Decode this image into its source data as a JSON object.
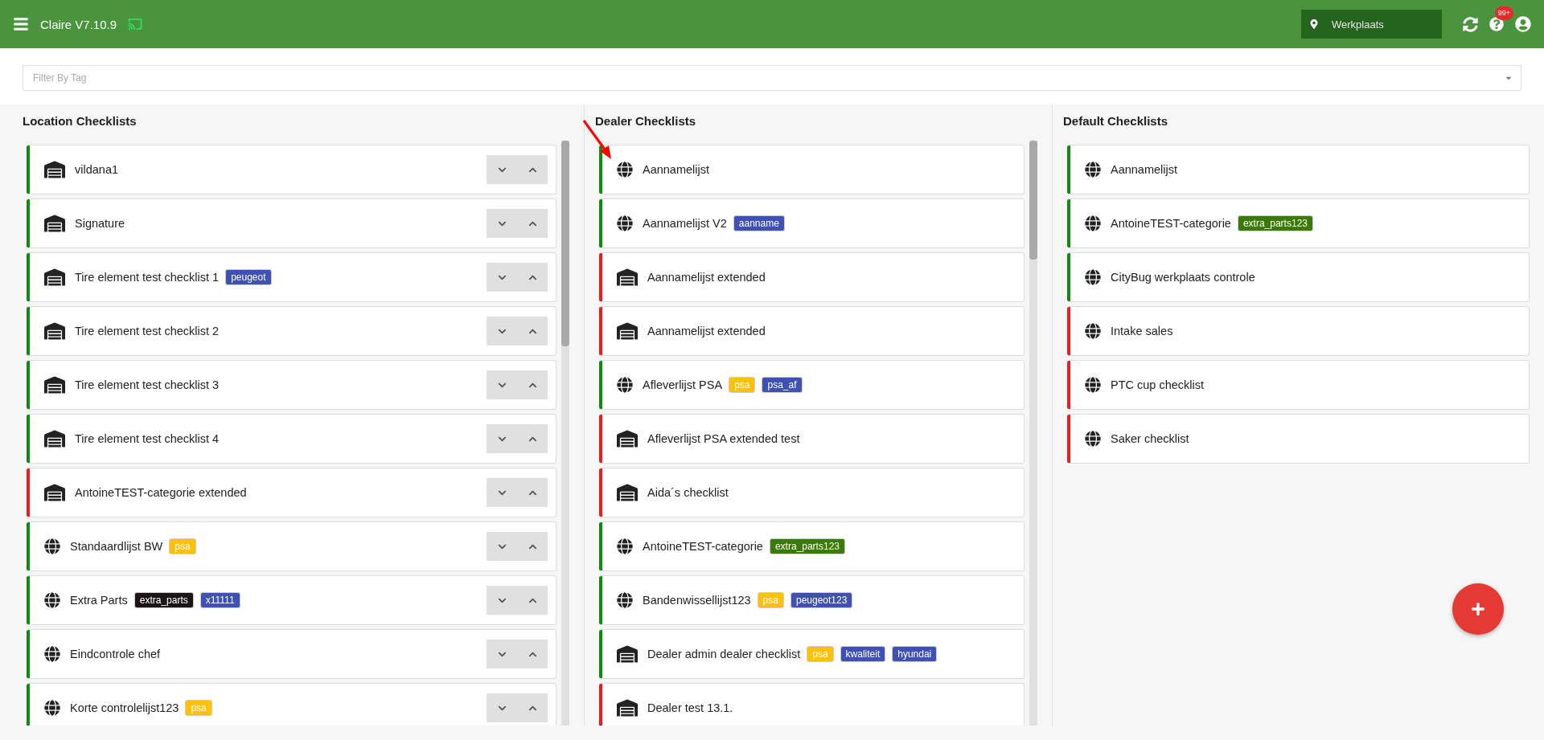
{
  "header": {
    "title": "Claire V7.10.9",
    "location": {
      "value": "Werkplaats"
    },
    "help_badge": "99+"
  },
  "filter": {
    "placeholder": "Filter By Tag"
  },
  "columns": [
    {
      "title": "Location Checklists",
      "reorderable": true,
      "scrollbar": true,
      "items": [
        {
          "name": "vildana1",
          "kind": "warehouse",
          "color": "#128a12"
        },
        {
          "name": "Signature",
          "kind": "warehouse",
          "color": "#128a12"
        },
        {
          "name": "Tire element test checklist 1",
          "kind": "warehouse",
          "color": "#128a12",
          "tags": [
            {
              "label": "peugeot",
              "color": "#3f51b5"
            }
          ]
        },
        {
          "name": "Tire element test checklist 2",
          "kind": "warehouse",
          "color": "#128a12"
        },
        {
          "name": "Tire element test checklist 3",
          "kind": "warehouse",
          "color": "#128a12"
        },
        {
          "name": "Tire element test checklist 4",
          "kind": "warehouse",
          "color": "#128a12"
        },
        {
          "name": "AntoineTEST-categorie extended",
          "kind": "warehouse",
          "color": "#ee1c1c"
        },
        {
          "name": "Standaardlijst BW",
          "kind": "globe",
          "color": "#128a12",
          "tags": [
            {
              "label": "psa",
              "color": "#ffc107"
            }
          ]
        },
        {
          "name": "Extra Parts",
          "kind": "globe",
          "color": "#128a12",
          "tags": [
            {
              "label": "extra_parts",
              "color": "#1c1418"
            },
            {
              "label": "x11111",
              "color": "#3f51b5"
            }
          ]
        },
        {
          "name": "Eindcontrole chef",
          "kind": "globe",
          "color": "#128a12"
        },
        {
          "name": "Korte controlelijst123",
          "kind": "globe",
          "color": "#128a12",
          "tags": [
            {
              "label": "psa",
              "color": "#ffc107"
            }
          ]
        }
      ]
    },
    {
      "title": "Dealer Checklists",
      "reorderable": false,
      "scrollbar": true,
      "items": [
        {
          "name": "Aannamelijst",
          "kind": "globe",
          "color": "#128a12"
        },
        {
          "name": "Aannamelijst V2",
          "kind": "globe",
          "color": "#128a12",
          "tags": [
            {
              "label": "aanname",
              "color": "#3f51b5"
            }
          ]
        },
        {
          "name": "Aannamelijst extended",
          "kind": "warehouse",
          "color": "#ee1c1c"
        },
        {
          "name": "Aannamelijst extended",
          "kind": "warehouse",
          "color": "#ee1c1c"
        },
        {
          "name": "Afleverlijst PSA",
          "kind": "globe",
          "color": "#128a12",
          "tags": [
            {
              "label": "psa",
              "color": "#ffc107"
            },
            {
              "label": "psa_af",
              "color": "#3f51b5"
            }
          ]
        },
        {
          "name": "Afleverlijst PSA extended test",
          "kind": "warehouse",
          "color": "#ee1c1c"
        },
        {
          "name": "Aida´s checklist",
          "kind": "warehouse",
          "color": "#ee1c1c"
        },
        {
          "name": "AntoineTEST-categorie",
          "kind": "globe",
          "color": "#128a12",
          "tags": [
            {
              "label": "extra_parts123",
              "color": "#3a7a08"
            }
          ]
        },
        {
          "name": "Bandenwissellijst123",
          "kind": "globe",
          "color": "#128a12",
          "tags": [
            {
              "label": "psa",
              "color": "#ffc107"
            },
            {
              "label": "peugeot123",
              "color": "#3f51b5"
            }
          ]
        },
        {
          "name": "Dealer admin dealer checklist",
          "kind": "warehouse",
          "color": "#128a12",
          "tags": [
            {
              "label": "psa",
              "color": "#ffc107"
            },
            {
              "label": "kwaliteit",
              "color": "#3f51b5"
            },
            {
              "label": "hyundai",
              "color": "#3f51b5"
            }
          ]
        },
        {
          "name": "Dealer test 13.1.",
          "kind": "warehouse",
          "color": "#ee1c1c"
        }
      ]
    },
    {
      "title": "Default Checklists",
      "reorderable": false,
      "scrollbar": false,
      "items": [
        {
          "name": "Aannamelijst",
          "kind": "globe",
          "color": "#128a12"
        },
        {
          "name": "AntoineTEST-categorie",
          "kind": "globe",
          "color": "#128a12",
          "tags": [
            {
              "label": "extra_parts123",
              "color": "#3a7a08"
            }
          ]
        },
        {
          "name": "CityBug werkplaats controle",
          "kind": "globe",
          "color": "#128a12"
        },
        {
          "name": "Intake sales",
          "kind": "globe",
          "color": "#ee1c1c"
        },
        {
          "name": "PTC cup checklist",
          "kind": "globe",
          "color": "#ee1c1c"
        },
        {
          "name": "Saker checklist",
          "kind": "globe",
          "color": "#ee1c1c"
        }
      ]
    }
  ]
}
